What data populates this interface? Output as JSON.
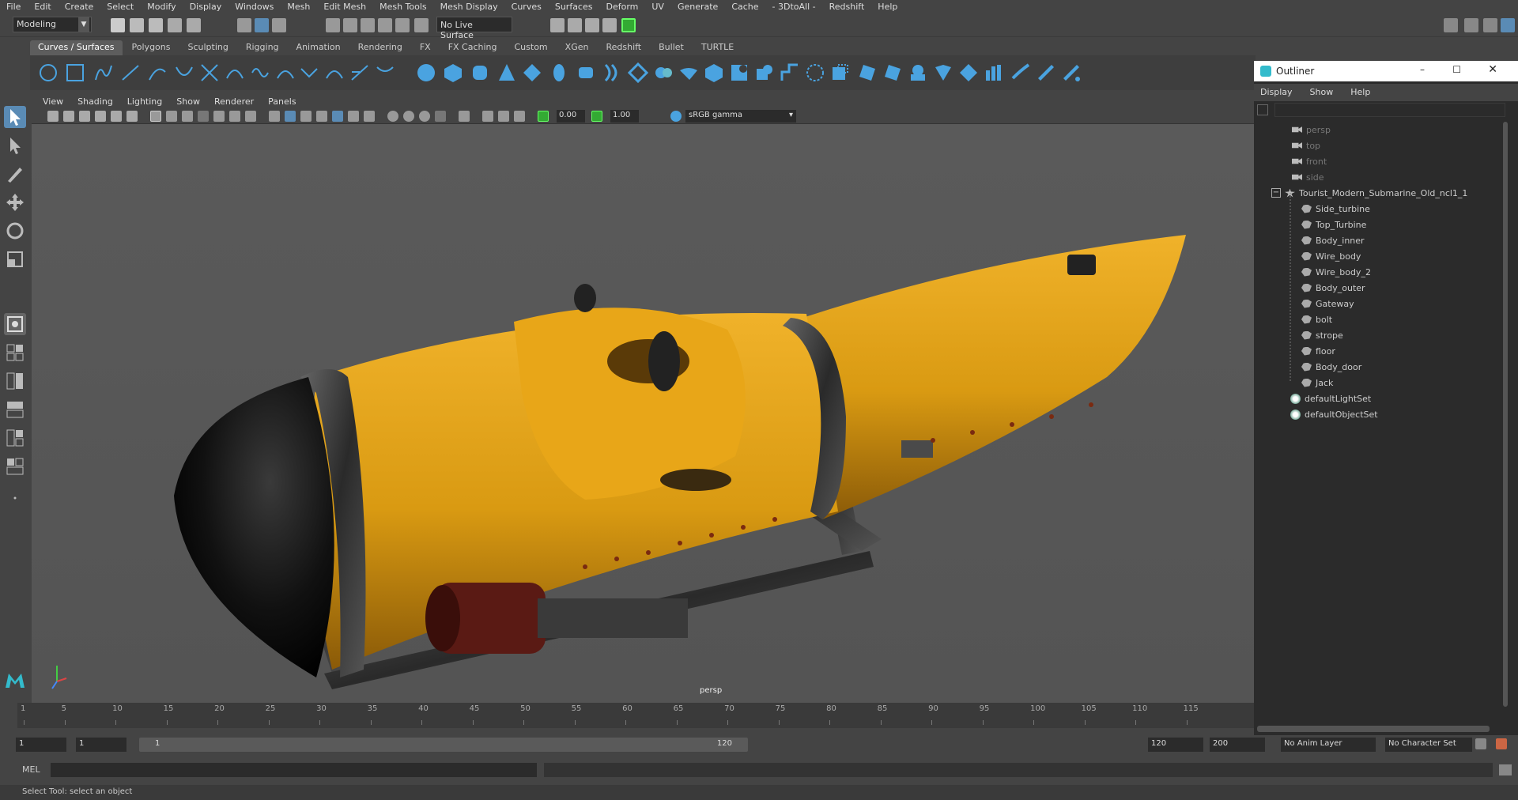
{
  "menubar": [
    "File",
    "Edit",
    "Create",
    "Select",
    "Modify",
    "Display",
    "Windows",
    "Mesh",
    "Edit Mesh",
    "Mesh Tools",
    "Mesh Display",
    "Curves",
    "Surfaces",
    "Deform",
    "UV",
    "Generate",
    "Cache",
    "- 3DtoAll -",
    "Redshift",
    "Help"
  ],
  "status": {
    "mode": "Modeling",
    "live_surface": "No Live Surface"
  },
  "shelf_tabs": [
    "Curves / Surfaces",
    "Polygons",
    "Sculpting",
    "Rigging",
    "Animation",
    "Rendering",
    "FX",
    "FX Caching",
    "Custom",
    "XGen",
    "Redshift",
    "Bullet",
    "TURTLE"
  ],
  "viewport": {
    "menu": [
      "View",
      "Shading",
      "Lighting",
      "Show",
      "Renderer",
      "Panels"
    ],
    "exposure": "0.00",
    "gamma_value": "1.00",
    "colorspace": "sRGB gamma",
    "camera_label": "persp"
  },
  "timeline": {
    "ticks": [
      "1",
      "5",
      "10",
      "15",
      "20",
      "25",
      "30",
      "35",
      "40",
      "45",
      "50",
      "55",
      "60",
      "65",
      "70",
      "75",
      "80",
      "85",
      "90",
      "95",
      "100",
      "105",
      "110",
      "115"
    ]
  },
  "range": {
    "start": "1",
    "current": "1",
    "slider_start": "1",
    "slider_end": "120",
    "end": "120",
    "max": "200",
    "anim_layer": "No Anim Layer",
    "char_set": "No Character Set"
  },
  "mel": {
    "label": "MEL"
  },
  "help_line": "Select Tool: select an object",
  "outliner": {
    "title": "Outliner",
    "menu": [
      "Display",
      "Show",
      "Help"
    ],
    "cameras": [
      "persp",
      "top",
      "front",
      "side"
    ],
    "group": "Tourist_Modern_Submarine_Old_ncl1_1",
    "children": [
      "Side_turbine",
      "Top_Turbine",
      "Body_inner",
      "Wire_body",
      "Wire_body_2",
      "Body_outer",
      "Gateway",
      "bolt",
      "strope",
      "floor",
      "Body_door",
      "Jack"
    ],
    "sets": [
      "defaultLightSet",
      "defaultObjectSet"
    ]
  },
  "colors": {
    "accent": "#5a8bb5",
    "shelf_icon": "#4aa3e0",
    "sub_body": "#e0a01c"
  }
}
